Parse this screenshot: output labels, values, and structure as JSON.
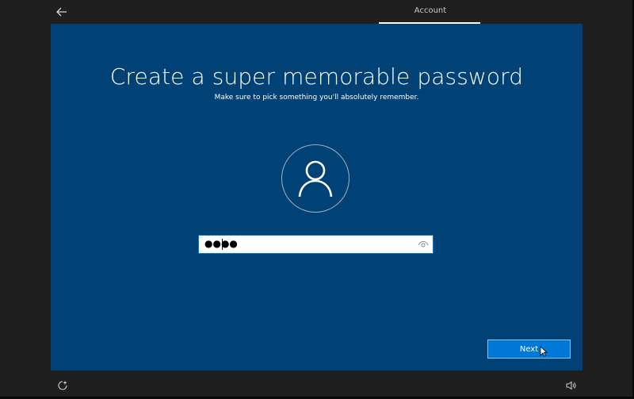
{
  "header": {
    "back_icon": "arrow-left-icon",
    "step_label": "Account"
  },
  "main": {
    "title": "Create a super memorable password",
    "subtitle": "Make sure to pick something you'll absolutely remember.",
    "avatar_icon": "user-icon",
    "password": {
      "masked_value": "●●●●",
      "reveal_icon": "eye-icon"
    },
    "next_label": "Next"
  },
  "footer": {
    "left_icon": "ease-of-access-icon",
    "right_icon": "volume-icon"
  },
  "colors": {
    "panel_bg": "#004275",
    "button_bg": "#0078d7",
    "frame_bg": "#1f1f1f"
  }
}
